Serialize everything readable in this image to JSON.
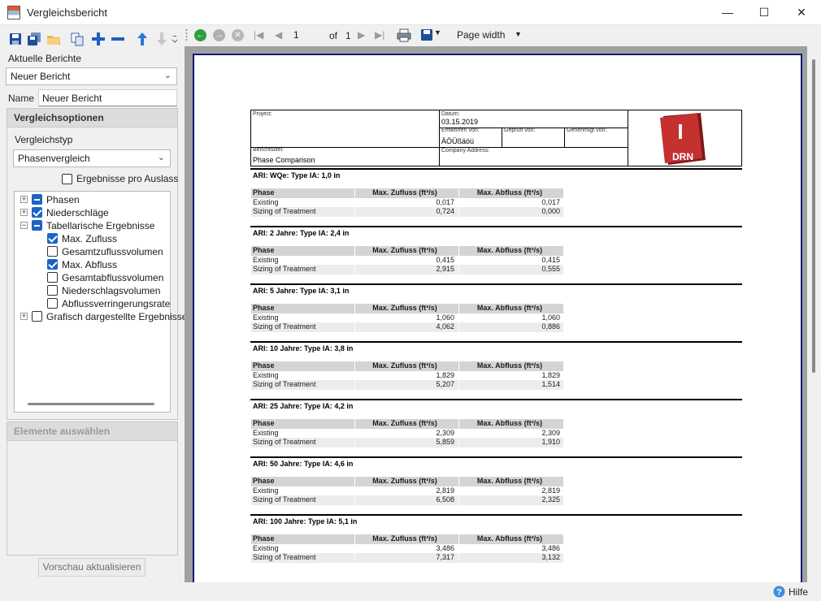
{
  "window": {
    "title": "Vergleichsbericht",
    "controls": {
      "minimize": "—",
      "maximize": "☐",
      "close": "✕"
    }
  },
  "left": {
    "toolbar_icons": [
      "save-icon",
      "save-all-icon",
      "open-folder-icon",
      "copy-icon",
      "add-icon",
      "remove-icon",
      "move-up-icon",
      "move-down-icon",
      "overflow-icon"
    ],
    "current_reports_label": "Aktuelle Berichte",
    "current_report_value": "Neuer Bericht",
    "name_label": "Name",
    "name_value": "Neuer Bericht",
    "options_header": "Vergleichsoptionen",
    "comparison_type_label": "Vergleichstyp",
    "comparison_type_value": "Phasenvergleich",
    "results_per_outlet_label": "Ergebnisse pro Auslass",
    "tree": [
      {
        "label": "Phasen",
        "state": "partial",
        "expander": "+"
      },
      {
        "label": "Niederschläge",
        "state": "checked",
        "expander": "+"
      },
      {
        "label": "Tabellarische Ergebnisse",
        "state": "partial",
        "expander": "−"
      },
      {
        "label": "Max. Zufluss",
        "state": "checked"
      },
      {
        "label": "Gesamtzuflussvolumen",
        "state": "unchecked"
      },
      {
        "label": "Max. Abfluss",
        "state": "checked"
      },
      {
        "label": "Gesamtabflussvolumen",
        "state": "unchecked"
      },
      {
        "label": "Niederschlagsvolumen",
        "state": "unchecked"
      },
      {
        "label": "Abflussverringerungsrate",
        "state": "unchecked"
      },
      {
        "label": "Grafisch dargestellte Ergebnisse",
        "state": "unchecked",
        "expander": "+"
      }
    ],
    "select_elements_header": "Elemente auswählen",
    "refresh_preview_button": "Vorschau aktualisieren"
  },
  "viewer_toolbar": {
    "page_current": "1",
    "page_of": "of",
    "page_total": "1",
    "zoom": "Page width",
    "print_icon": "print-icon",
    "export_icon": "save-export-icon"
  },
  "report": {
    "header": {
      "project_label": "Project:",
      "date_label": "Datum:",
      "date_value": "03.15.2019",
      "designed_by_label": "Entworfen von:",
      "designed_by_value": "ÄÖÜßäöü",
      "checked_by_label": "Geprüft von:",
      "approved_by_label": "Genehmigt von:",
      "report_title_label": "Berichtstitel:",
      "report_title_value": "Phase Comparison",
      "company_address_label": "Company Address:",
      "logo_letter": "I",
      "logo_text": "DRN"
    },
    "col_headers": [
      "Phase",
      "Max. Zufluss (ft³/s)",
      "Max. Abfluss (ft³/s)"
    ],
    "sections": [
      {
        "title": "ARI: WQe: Type IA: 1,0 in",
        "rows": [
          [
            "Existing",
            "0,017",
            "0,017"
          ],
          [
            "Sizing of Treatment",
            "0,724",
            "0,000"
          ]
        ]
      },
      {
        "title": "ARI: 2 Jahre: Type IA: 2,4 in",
        "rows": [
          [
            "Existing",
            "0,415",
            "0,415"
          ],
          [
            "Sizing of Treatment",
            "2,915",
            "0,555"
          ]
        ]
      },
      {
        "title": "ARI: 5 Jahre: Type IA: 3,1 in",
        "rows": [
          [
            "Existing",
            "1,060",
            "1,060"
          ],
          [
            "Sizing of Treatment",
            "4,062",
            "0,886"
          ]
        ]
      },
      {
        "title": "ARI: 10 Jahre: Type IA: 3,8 in",
        "rows": [
          [
            "Existing",
            "1,829",
            "1,829"
          ],
          [
            "Sizing of Treatment",
            "5,207",
            "1,514"
          ]
        ]
      },
      {
        "title": "ARI: 25 Jahre: Type IA: 4,2 in",
        "rows": [
          [
            "Existing",
            "2,309",
            "2,309"
          ],
          [
            "Sizing of Treatment",
            "5,859",
            "1,910"
          ]
        ]
      },
      {
        "title": "ARI: 50 Jahre: Type IA: 4,6 in",
        "rows": [
          [
            "Existing",
            "2,819",
            "2,819"
          ],
          [
            "Sizing of Treatment",
            "6,508",
            "2,325"
          ]
        ]
      },
      {
        "title": "ARI: 100 Jahre: Type IA: 5,1 in",
        "rows": [
          [
            "Existing",
            "3,486",
            "3,486"
          ],
          [
            "Sizing of Treatment",
            "7,317",
            "3,132"
          ]
        ]
      }
    ]
  },
  "status": {
    "help_label": "Hilfe"
  },
  "colors": {
    "accent_blue": "#1a64c8",
    "logo_red": "#c4312f",
    "page_border": "#0a1a6e",
    "nav_green": "#2e9e3e"
  }
}
